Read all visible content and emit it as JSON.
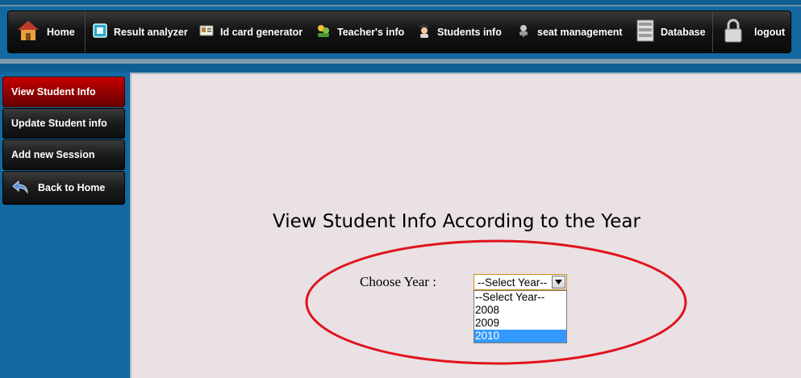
{
  "nav": {
    "items": [
      {
        "label": "Home",
        "icon": "house-icon"
      },
      {
        "label": "Result analyzer",
        "icon": "chart-icon"
      },
      {
        "label": "Id card generator",
        "icon": "id-card-icon"
      },
      {
        "label": "Teacher's info",
        "icon": "teachers-icon"
      },
      {
        "label": "Students info",
        "icon": "student-icon"
      },
      {
        "label": "seat management",
        "icon": "seat-icon"
      },
      {
        "label": "Database",
        "icon": "database-icon"
      },
      {
        "label": "logout",
        "icon": "padlock-icon"
      }
    ]
  },
  "sidebar": {
    "items": [
      {
        "label": "View Student Info",
        "active": true
      },
      {
        "label": "Update Student info"
      },
      {
        "label": "Add new Session"
      },
      {
        "label": "Back to Home",
        "icon": "back-arrow-icon"
      }
    ]
  },
  "content": {
    "heading": "View Student Info According to the Year",
    "choose_label": "Choose Year :",
    "select_value": "--Select Year--",
    "options": [
      "--Select Year--",
      "2008",
      "2009",
      "2010"
    ],
    "highlighted_option": "2010"
  },
  "colors": {
    "page_background": "#1268a0",
    "active_sidebar": "#a00000",
    "content_background": "#e9e1e4",
    "highlight": "#3399ff",
    "annotation_ellipse": "#e0141e"
  }
}
